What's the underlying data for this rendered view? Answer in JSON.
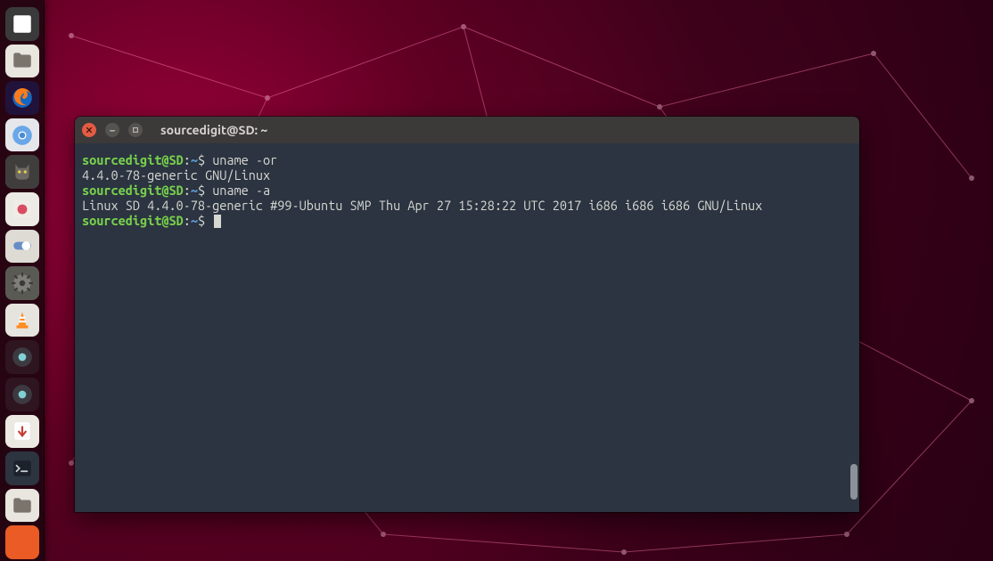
{
  "launcher": {
    "items": [
      {
        "name": "dash-icon",
        "kind": "dash"
      },
      {
        "name": "files-icon",
        "kind": "files"
      },
      {
        "name": "firefox-icon",
        "kind": "firefox"
      },
      {
        "name": "chromium-icon",
        "kind": "chromium"
      },
      {
        "name": "gimp-icon",
        "kind": "cat"
      },
      {
        "name": "app-icon",
        "kind": "app"
      },
      {
        "name": "toggle-icon",
        "kind": "toggle"
      },
      {
        "name": "system-settings-icon",
        "kind": "settings"
      },
      {
        "name": "vlc-icon",
        "kind": "vlc"
      },
      {
        "name": "privacy-icon",
        "kind": "pw"
      },
      {
        "name": "privacy2-icon",
        "kind": "pw"
      },
      {
        "name": "transmission-icon",
        "kind": "transmission"
      },
      {
        "name": "terminal-icon",
        "kind": "terminal"
      },
      {
        "name": "files3-icon",
        "kind": "files"
      },
      {
        "name": "drive-icon",
        "kind": "orange"
      }
    ]
  },
  "window": {
    "title": "sourcedigit@SD: ~",
    "prompt": {
      "user_host": "sourcedigit@SD",
      "sep": ":",
      "path": "~",
      "symbol": "$"
    },
    "lines": [
      {
        "type": "prompt",
        "cmd": "uname -or"
      },
      {
        "type": "out",
        "text": "4.4.0-78-generic GNU/Linux"
      },
      {
        "type": "prompt",
        "cmd": "uname -a"
      },
      {
        "type": "out",
        "text": "Linux SD 4.4.0-78-generic #99-Ubuntu SMP Thu Apr 27 15:28:22 UTC 2017 i686 i686 i686 GNU/Linux"
      },
      {
        "type": "prompt",
        "cmd": "",
        "cursor": true
      }
    ]
  }
}
